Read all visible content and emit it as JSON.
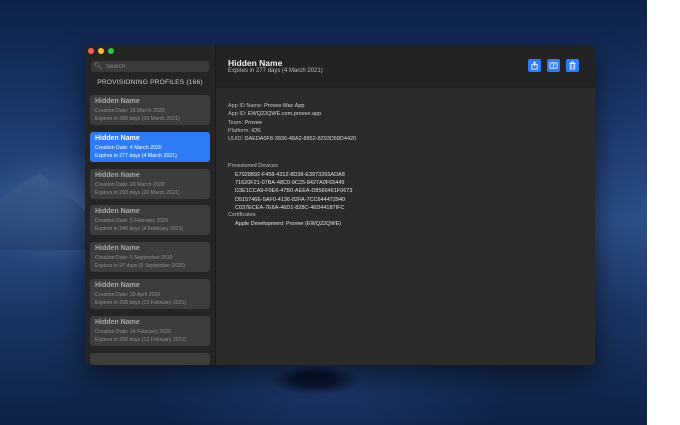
{
  "window": {
    "search": {
      "placeholder": "Search",
      "icon": "magnifier-icon"
    },
    "sidebar_title": "PROVISIONING PROFILES (166)",
    "profiles": [
      {
        "name": "Hidden Name",
        "created": "Creation Date: 16 March 2020",
        "expires": "Expires in 289 days (16 March 2021)",
        "selected": false
      },
      {
        "name": "Hidden Name",
        "created": "Creation Date: 4 March 2020",
        "expires": "Expires in 277 days (4 March 2021)",
        "selected": true
      },
      {
        "name": "Hidden Name",
        "created": "Creation Date: 20 March 2020",
        "expires": "Expires in 293 days (20 March 2021)",
        "selected": false
      },
      {
        "name": "Hidden Name",
        "created": "Creation Date: 5 February 2020",
        "expires": "Expires in 249 days (4 February 2021)",
        "selected": false
      },
      {
        "name": "Hidden Name",
        "created": "Creation Date: 6 September 2019",
        "expires": "Expires in 97 days (5 September 2020)",
        "selected": false
      },
      {
        "name": "Hidden Name",
        "created": "Creation Date: 20 April 2020",
        "expires": "Expires in 258 days (13 February 2021)",
        "selected": false
      },
      {
        "name": "Hidden Name",
        "created": "Creation Date: 14 February 2020",
        "expires": "Expires in 258 days (13 February 2021)",
        "selected": false
      }
    ],
    "detail": {
      "title": "Hidden Name",
      "subtitle": "Expires in 277 days (4 March 2021)",
      "info": [
        {
          "label": "App ID Name:",
          "value": "Provee Mac App"
        },
        {
          "label": "App ID:",
          "value": "EWQ22QWE.com.provee.app"
        },
        {
          "label": "Team:",
          "value": "Provee"
        },
        {
          "label": "Platform:",
          "value": "iOS"
        },
        {
          "label": "UUID:",
          "value": "DAEDA0F8-3836-48A2-8862-8293D58D4420"
        }
      ],
      "devices_title": "Provisioned Devices",
      "devices": [
        "E7928892-F458-4312-8D38-E3973265ADA8",
        "71620F21-07BA-48C0-9C25-8427A0F65449",
        "D3E1CCA9-F0E6-47B0-AEEA-D8566461F0673",
        "D515746E-5AF0-4136-82FA-7CC644472940",
        "C037ECEA-7E6A-46D1-828C-46D44187IFC"
      ],
      "certificates_title": "Certificates",
      "certificates": [
        "Apple Development: Provee (EWQ22QWE)"
      ],
      "actions": [
        {
          "name": "share-button",
          "icon": "share-icon"
        },
        {
          "name": "show-in-finder-button",
          "icon": "finder-icon"
        },
        {
          "name": "delete-button",
          "icon": "trash-icon"
        }
      ]
    }
  }
}
